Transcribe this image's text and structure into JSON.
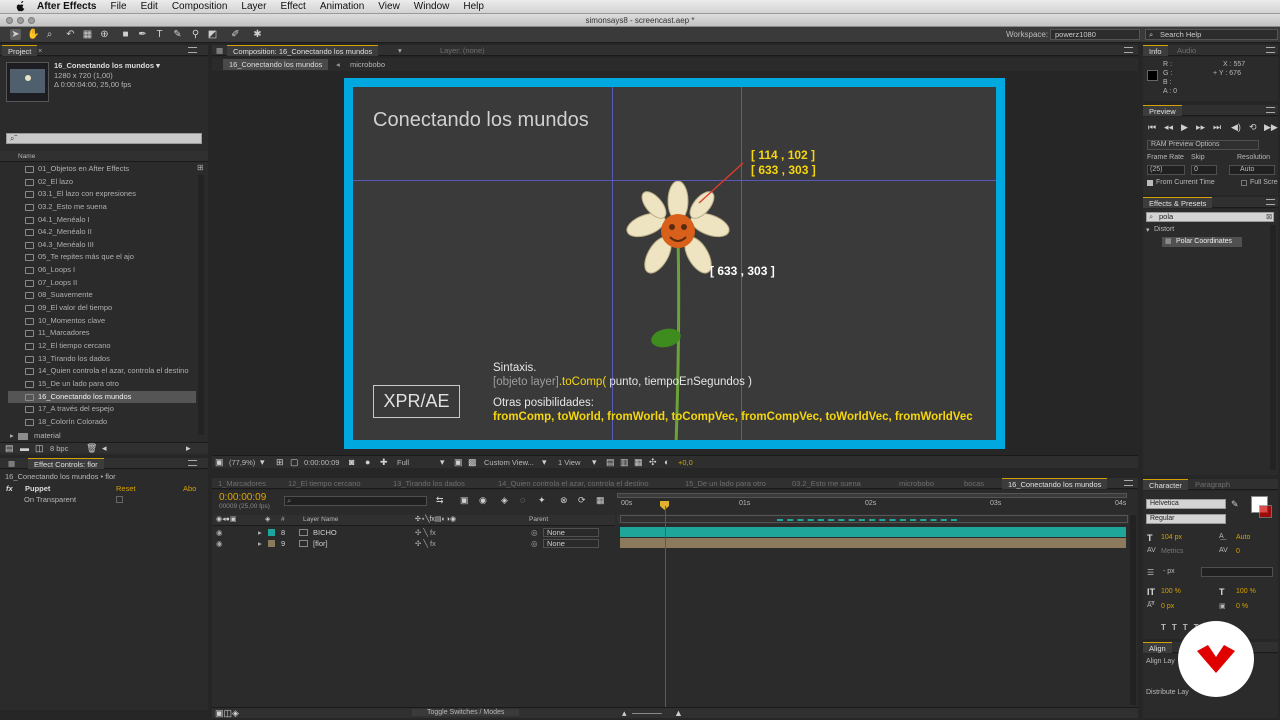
{
  "menubar": {
    "app": "After Effects",
    "items": [
      "File",
      "Edit",
      "Composition",
      "Layer",
      "Effect",
      "Animation",
      "View",
      "Window",
      "Help"
    ]
  },
  "window_title": "simonsays8 - screencast.aep *",
  "workspace": {
    "label": "Workspace:",
    "value": "powerz1080"
  },
  "search_help": "Search Help",
  "project": {
    "tab": "Project",
    "comp_name": "16_Conectando los mundos ▾",
    "comp_size": "1280 x 720 (1,00)",
    "comp_duration": "Δ 0:00:04:00, 25,00 fps",
    "search_placeholder": "⌕˜",
    "column_name": "Name",
    "items": [
      "01_Objetos en After Effects",
      "02_El lazo",
      "03.1_El lazo con expresiones",
      "03.2_Esto me suena",
      "04.1_Menéalo I",
      "04.2_Menéalo II",
      "04.3_Menéalo III",
      "05_Te repites más que el ajo",
      "06_Loops I",
      "07_Loops II",
      "08_Suavemente",
      "09_El valor del tiempo",
      "10_Momentos clave",
      "11_Marcadores",
      "12_El tiempo cercano",
      "13_Tirando los dados",
      "14_Quien controla el azar, controla el destino",
      "15_De un lado para otro",
      "16_Conectando los mundos",
      "17_A través del espejo",
      "18_Colorín Colorado"
    ],
    "selected_index": 18,
    "folder": "material",
    "bpc": "8 bpc"
  },
  "effect_controls": {
    "tab": "Effect Controls: flor",
    "path": "16_Conectando los mundos • flor",
    "effect_name": "Puppet",
    "reset": "Reset",
    "about": "Abo",
    "option": "On Transparent"
  },
  "composition": {
    "tab": "Composition: 16_Conectando los mundos",
    "layer_tab": "Layer: (none)",
    "breadcrumb_active": "16_Conectando los mundos",
    "breadcrumb_next": "microbobo",
    "heading": "Conectando los mundos",
    "coord_top1": "[ 114 , 102 ]",
    "coord_top2": "[ 633 , 303 ]",
    "coord_mid": "[ 633 , 303 ]",
    "logo": "XPR/AE",
    "syntax_label": "Sintaxis.",
    "syntax_obj": "[objeto layer]",
    "syntax_method": ".toComp(",
    "syntax_args": " punto, tiempoEnSegundos )",
    "other_label": "Otras posibilidades:",
    "other_list": "fromComp, toWorld, fromWorld, toCompVec, fromCompVec, toWorldVec, fromWorldVec"
  },
  "viewer_footer": {
    "zoom": "(77,9%)",
    "timecode": "0:00:00:09",
    "quality": "Full",
    "view": "Custom View...",
    "views": "1 View",
    "exposure": "+0,0"
  },
  "timeline": {
    "tabs": [
      "1_Marcadores",
      "12_El tiempo cercano",
      "13_Tirando los dados",
      "14_Quien controla el azar, controla el destino",
      "15_De un lado para otro",
      "03.2_Esto me suena",
      "microbobo",
      "bocas",
      "16_Conectando los mundos"
    ],
    "timecode": "0:00:00:09",
    "frame_info": "00009 (25,00 fps)",
    "col_hash": "#",
    "col_layer": "Layer Name",
    "col_parent": "Parent",
    "layers": [
      {
        "num": "8",
        "name": "BICHO",
        "parent": "None",
        "color": "#1fa69a"
      },
      {
        "num": "9",
        "name": "[flor]",
        "parent": "None",
        "color": "#8b7a5c"
      }
    ],
    "ruler": [
      "00s",
      "01s",
      "02s",
      "03s",
      "04s"
    ],
    "toggle": "Toggle Switches / Modes"
  },
  "info": {
    "tab": "Info",
    "audio_tab": "Audio",
    "r": "R :",
    "g": "G :",
    "b": "B :",
    "a": "A : 0",
    "x": "X : 557",
    "y": "+ Y : 676"
  },
  "preview": {
    "tab": "Preview",
    "ram": "RAM Preview Options",
    "frame_rate_label": "Frame Rate",
    "skip_label": "Skip",
    "resolution_label": "Resolution",
    "frame_rate": "(25)",
    "skip": "0",
    "resolution": "Auto",
    "from_current": "From Current Time",
    "full_screen": "Full Screen"
  },
  "effects_presets": {
    "tab": "Effects & Presets",
    "search": "pola",
    "category": "Distort",
    "item": "Polar Coordinates"
  },
  "character": {
    "tab": "Character",
    "para_tab": "Paragraph",
    "font": "Helvetica",
    "style": "Regular",
    "size": "104 px",
    "leading": "Auto",
    "kerning": "Metrics",
    "tracking": "0",
    "stroke": "- px",
    "vscale": "100 %",
    "hscale": "100 %",
    "baseline": "0 px",
    "tsume": "0 %"
  },
  "align": {
    "tab": "Align",
    "align_layers": "Align Lay",
    "distribute": "Distribute Lay"
  },
  "colors": {
    "accent": "#d4a000",
    "frame": "#00a8e0",
    "guide": "#5c5cc8",
    "teal_layer": "#1fa69a",
    "tan_layer": "#8b7a5c",
    "badge": "#e00000"
  }
}
